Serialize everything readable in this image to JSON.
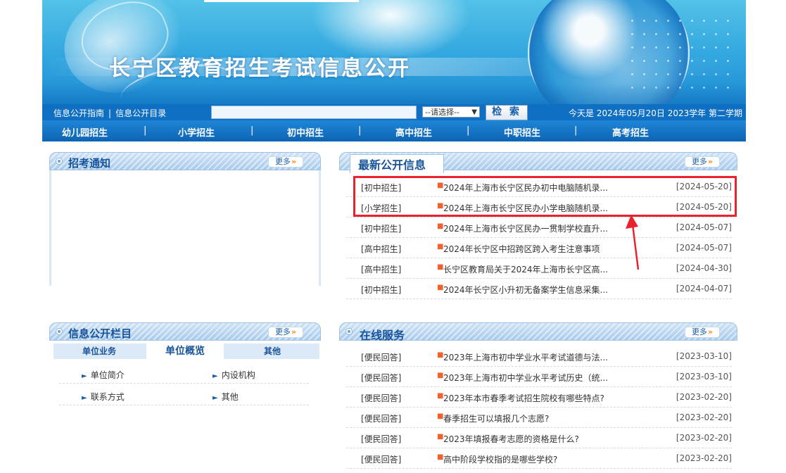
{
  "header": {
    "title": "长宁区教育招生考试信息公开"
  },
  "search_bar": {
    "links": [
      "信息公开指南",
      "信息公开目录"
    ],
    "separator": "|",
    "search_input_value": "",
    "select_value": "--请选择--",
    "search_button": "检 索",
    "date_text": "今天是 2024年05月20日 2023学年 第二学期"
  },
  "nav": {
    "items": [
      "幼儿园招生",
      "小学招生",
      "初中招生",
      "高中招生",
      "中职招生",
      "高考招生"
    ],
    "separator": "|"
  },
  "notice_panel": {
    "title": "招考通知",
    "more": "更多"
  },
  "latest_panel": {
    "title": "最新公开信息",
    "more": "更多",
    "items": [
      {
        "category": "[初中招生]",
        "title": "2024年上海市长宁区民办初中电脑随机录...",
        "date": "[2024-05-20]"
      },
      {
        "category": "[小学招生]",
        "title": "2024年上海市长宁区民办小学电脑随机录...",
        "date": "[2024-05-20]"
      },
      {
        "category": "[初中招生]",
        "title": "2024年上海市长宁区民办一贯制学校直升...",
        "date": "[2024-05-07]"
      },
      {
        "category": "[高中招生]",
        "title": "2024年长宁区中招跨区跨入考生注意事项",
        "date": "[2024-05-07]"
      },
      {
        "category": "[高中招生]",
        "title": "长宁区教育局关于2024年上海市长宁区高...",
        "date": "[2024-04-30]"
      },
      {
        "category": "[初中招生]",
        "title": "2024年长宁区小升初无备案学生信息采集...",
        "date": "[2024-04-07]"
      }
    ]
  },
  "info_column_panel": {
    "title": "信息公开栏目",
    "more": "更多",
    "tabs": [
      "单位业务",
      "单位概览",
      "其他"
    ],
    "links": [
      "单位简介",
      "内设机构",
      "联系方式",
      "其他"
    ]
  },
  "online_service_panel": {
    "title": "在线服务",
    "more": "更多",
    "items": [
      {
        "category": "[便民回答]",
        "title": "2023年上海市初中学业水平考试道德与法...",
        "date": "[2023-03-10]"
      },
      {
        "category": "[便民回答]",
        "title": "2023年上海市初中学业水平考试历史（统...",
        "date": "[2023-03-10]"
      },
      {
        "category": "[便民回答]",
        "title": "2023年本市春季考试招生院校有哪些特点?",
        "date": "[2023-02-20]"
      },
      {
        "category": "[便民回答]",
        "title": "春季招生可以填报几个志愿?",
        "date": "[2023-02-20]"
      },
      {
        "category": "[便民回答]",
        "title": "2023年填报春考志愿的资格是什么?",
        "date": "[2023-02-20]"
      },
      {
        "category": "[便民回答]",
        "title": "高中阶段学校指的是哪些学校?",
        "date": "[2023-02-20]"
      }
    ]
  },
  "colors": {
    "nav_blue": "#0d63b4",
    "panel_title": "#17549b",
    "highlight_red": "#e8232d",
    "bullet_orange": "#f0612e"
  }
}
